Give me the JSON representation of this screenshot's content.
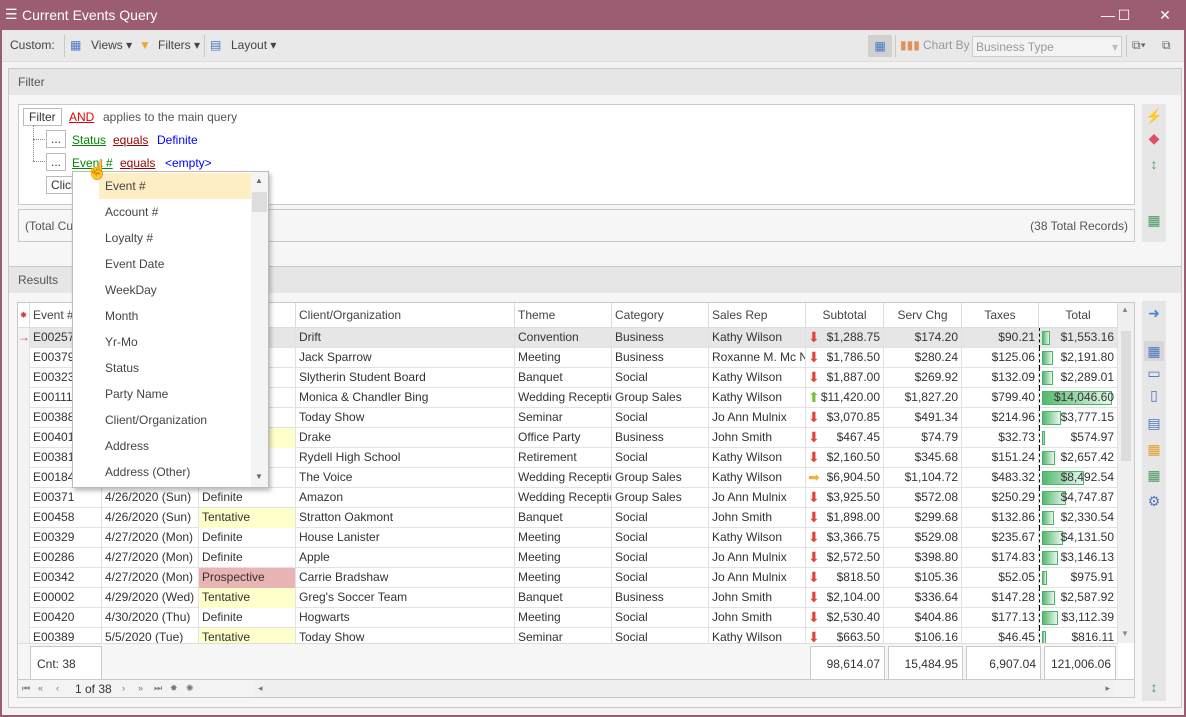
{
  "window": {
    "title": "Current Events Query",
    "min": "—",
    "max": "☐",
    "close": "✕"
  },
  "toolbar": {
    "custom_label": "Custom:",
    "views": "Views",
    "filters": "Filters",
    "layout": "Layout",
    "chart_by_label": "Chart By",
    "chart_by_value": "Business Type"
  },
  "filter": {
    "header": "Filter",
    "root_button": "Filter",
    "operator": "AND",
    "operator_text": "applies to the main query",
    "conditions": [
      {
        "btn": "...",
        "field": "Status",
        "op": "equals",
        "value": "Definite"
      },
      {
        "btn": "...",
        "field": "Event #",
        "op": "equals",
        "value": "<empty>"
      }
    ],
    "add_button": "Click",
    "totals_left": "(Total Cu",
    "totals_right": "(38 Total Records)"
  },
  "field_dropdown": {
    "items": [
      "Event #",
      "Account #",
      "Loyalty #",
      "Event Date",
      "WeekDay",
      "Month",
      "Yr-Mo",
      "Status",
      "Party Name",
      "Client/Organization",
      "Address",
      "Address (Other)"
    ],
    "selected": "Event #"
  },
  "results": {
    "header": "Results",
    "columns": [
      "Event #",
      "Event Date",
      "Status",
      "Client/Organization",
      "Theme",
      "Category",
      "Sales Rep",
      "Subtotal",
      "Serv Chg",
      "Taxes",
      "Total"
    ],
    "rows": [
      [
        "E00257",
        "",
        "",
        "Drift",
        "Convention",
        "Business",
        "Kathy Wilson",
        "down",
        "$1,288.75",
        "$174.20",
        "$90.21",
        "$1,553.16"
      ],
      [
        "E00379",
        "",
        "",
        "Jack Sparrow",
        "Meeting",
        "Business",
        "Roxanne M. Mc N",
        "down",
        "$1,786.50",
        "$280.24",
        "$125.06",
        "$2,191.80"
      ],
      [
        "E00323",
        "",
        "",
        "Slytherin Student Board",
        "Banquet",
        "Social",
        "Kathy Wilson",
        "down",
        "$1,887.00",
        "$269.92",
        "$132.09",
        "$2,289.01"
      ],
      [
        "E00111",
        "",
        "",
        "Monica & Chandler Bing",
        "Wedding Reception",
        "Group Sales",
        "Kathy Wilson",
        "up",
        "$11,420.00",
        "$1,827.20",
        "$799.40",
        "$14,046.60"
      ],
      [
        "E00388",
        "",
        "",
        "Today Show",
        "Seminar",
        "Social",
        "Jo Ann Mulnix",
        "down",
        "$3,070.85",
        "$491.34",
        "$214.96",
        "$3,777.15"
      ],
      [
        "E00401",
        "",
        "",
        "Drake",
        "Office Party",
        "Business",
        "John Smith",
        "down",
        "$467.45",
        "$74.79",
        "$32.73",
        "$574.97"
      ],
      [
        "E00381",
        "",
        "",
        "Rydell High School",
        "Retirement",
        "Social",
        "Kathy Wilson",
        "down",
        "$2,160.50",
        "$345.68",
        "$151.24",
        "$2,657.42"
      ],
      [
        "E00184",
        "",
        "",
        "The Voice",
        "Wedding Reception",
        "Group Sales",
        "Kathy Wilson",
        "right",
        "$6,904.50",
        "$1,104.72",
        "$483.32",
        "$8,492.54"
      ],
      [
        "E00371",
        "4/26/2020 (Sun)",
        "Definite",
        "Amazon",
        "Wedding Reception",
        "Group Sales",
        "Jo Ann Mulnix",
        "down",
        "$3,925.50",
        "$572.08",
        "$250.29",
        "$4,747.87"
      ],
      [
        "E00458",
        "4/26/2020 (Sun)",
        "Tentative",
        "Stratton Oakmont",
        "Banquet",
        "Social",
        "John Smith",
        "down",
        "$1,898.00",
        "$299.68",
        "$132.86",
        "$2,330.54"
      ],
      [
        "E00329",
        "4/27/2020 (Mon)",
        "Definite",
        "House Lanister",
        "Meeting",
        "Social",
        "Kathy Wilson",
        "down",
        "$3,366.75",
        "$529.08",
        "$235.67",
        "$4,131.50"
      ],
      [
        "E00286",
        "4/27/2020 (Mon)",
        "Definite",
        "Apple",
        "Meeting",
        "Social",
        "Jo Ann Mulnix",
        "down",
        "$2,572.50",
        "$398.80",
        "$174.83",
        "$3,146.13"
      ],
      [
        "E00342",
        "4/27/2020 (Mon)",
        "Prospective",
        "Carrie Bradshaw",
        "Meeting",
        "Social",
        "Jo Ann Mulnix",
        "down",
        "$818.50",
        "$105.36",
        "$52.05",
        "$975.91"
      ],
      [
        "E00002",
        "4/29/2020 (Wed)",
        "Tentative",
        "Greg's Soccer Team",
        "Banquet",
        "Business",
        "John Smith",
        "down",
        "$2,104.00",
        "$336.64",
        "$147.28",
        "$2,587.92"
      ],
      [
        "E00420",
        "4/30/2020 (Thu)",
        "Definite",
        "Hogwarts",
        "Meeting",
        "Social",
        "John Smith",
        "down",
        "$2,530.40",
        "$404.86",
        "$177.13",
        "$3,112.39"
      ],
      [
        "E00389",
        "5/5/2020 (Tue)",
        "Tentative",
        "Today Show",
        "Seminar",
        "Social",
        "Kathy Wilson",
        "down",
        "$663.50",
        "$106.16",
        "$46.45",
        "$816.11"
      ]
    ],
    "total_values": [
      1553.16,
      2191.8,
      2289.01,
      14046.6,
      3777.15,
      574.97,
      2657.42,
      8492.54,
      4747.87,
      2330.54,
      4131.5,
      3146.13,
      975.91,
      2587.92,
      3112.39,
      816.11
    ],
    "hidden_status_highlight": {
      "5": "tentative"
    },
    "summary": {
      "count": "Cnt: 38",
      "subtotal": "98,614.07",
      "serv_chg": "15,484.95",
      "taxes": "6,907.04",
      "total": "121,006.06"
    },
    "nav": {
      "position": "1 of 38"
    }
  },
  "colors": {
    "titlebar": "#9c5d72",
    "tentative": "#ffffcc",
    "prospective": "#e8b4b4",
    "selected_row": "#e6e6e6",
    "dropdown_highlight": "#fdeec4",
    "trend_down": "#e0463c",
    "trend_up": "#7cc043",
    "trend_flat": "#f3b43f"
  }
}
